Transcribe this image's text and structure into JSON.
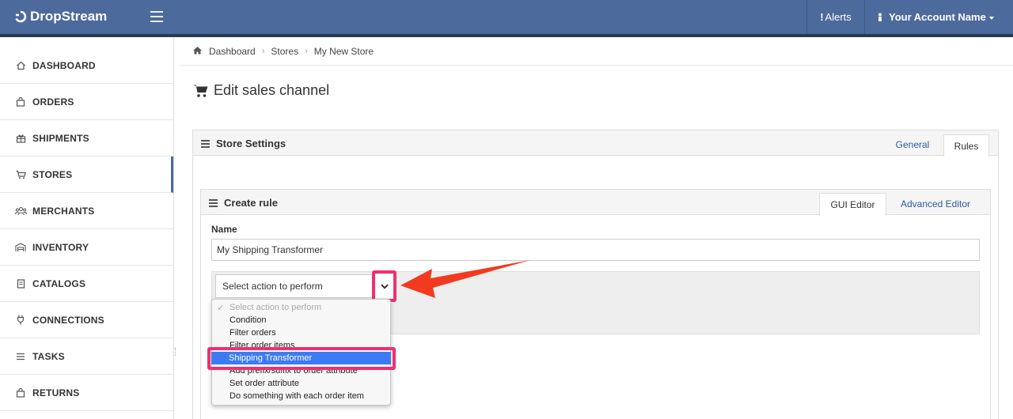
{
  "app": {
    "name": "DropStream"
  },
  "topbar": {
    "alerts_label": "Alerts",
    "account_label": "Your Account Name"
  },
  "sidebar": {
    "items": [
      {
        "label": "DASHBOARD",
        "icon": "home-icon"
      },
      {
        "label": "ORDERS",
        "icon": "bag-icon"
      },
      {
        "label": "SHIPMENTS",
        "icon": "gift-icon"
      },
      {
        "label": "STORES",
        "icon": "cart-icon",
        "active": true
      },
      {
        "label": "MERCHANTS",
        "icon": "users-icon"
      },
      {
        "label": "INVENTORY",
        "icon": "warehouse-icon"
      },
      {
        "label": "CATALOGS",
        "icon": "book-icon"
      },
      {
        "label": "CONNECTIONS",
        "icon": "plug-icon"
      },
      {
        "label": "TASKS",
        "icon": "list-icon"
      },
      {
        "label": "RETURNS",
        "icon": "bag-icon"
      }
    ]
  },
  "breadcrumb": {
    "items": [
      "Dashboard",
      "Stores",
      "My New Store"
    ]
  },
  "page": {
    "title": "Edit sales channel"
  },
  "store_settings": {
    "title": "Store Settings",
    "tabs": [
      {
        "label": "General",
        "active": false
      },
      {
        "label": "Rules",
        "active": true
      }
    ]
  },
  "create_rule": {
    "title": "Create rule",
    "tabs": [
      {
        "label": "GUI Editor",
        "active": true
      },
      {
        "label": "Advanced Editor",
        "active": false
      }
    ],
    "name_label": "Name",
    "name_value": "My Shipping Transformer",
    "action_select": {
      "placeholder": "Select action to perform",
      "options": [
        "Select action to perform",
        "Condition",
        "Filter orders",
        "Filter order items",
        "Shipping Transformer",
        "Add prefix/suffix to order attribute",
        "Set order attribute",
        "Do something with each order item"
      ],
      "highlighted_option": "Shipping Transformer"
    }
  },
  "colors": {
    "topbar": "#4d6a9d",
    "highlight": "#f0306e",
    "arrow": "#f23a1f",
    "selected_option": "#3d7bf5",
    "link": "#2a5d9b"
  }
}
